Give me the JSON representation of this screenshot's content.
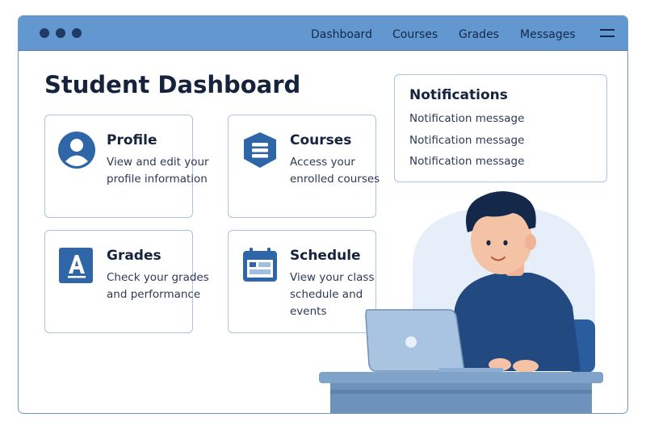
{
  "window": {
    "controls": [
      "window-dot",
      "window-dot",
      "window-dot"
    ]
  },
  "nav": {
    "links": [
      "Dashboard",
      "Courses",
      "Grades",
      "Messages"
    ],
    "menu_icon": "hamburger-menu-icon"
  },
  "page": {
    "title": "Student Dashboard"
  },
  "cards": [
    {
      "title": "Profile",
      "description": "View and edit your profile information",
      "icon": "user-profile-icon"
    },
    {
      "title": "Courses",
      "description": "Access your enrolled courses",
      "icon": "book-stack-icon"
    },
    {
      "title": "Grades",
      "description": "Check your grades and performance",
      "icon": "grade-a-icon"
    },
    {
      "title": "Schedule",
      "description": "View your class schedule and events",
      "icon": "calendar-icon"
    }
  ],
  "notifications": {
    "title": "Notifications",
    "items": [
      "Notification message",
      "Notification message",
      "Notification message"
    ]
  },
  "colors": {
    "titlebar": "#6397cf",
    "accent": "#2d5d9c",
    "icon_blue": "#2f66a8",
    "card_border": "#aac4e2",
    "text_dark": "#16233d",
    "shirt": "#234a80",
    "desk": "#7fa3c9"
  }
}
